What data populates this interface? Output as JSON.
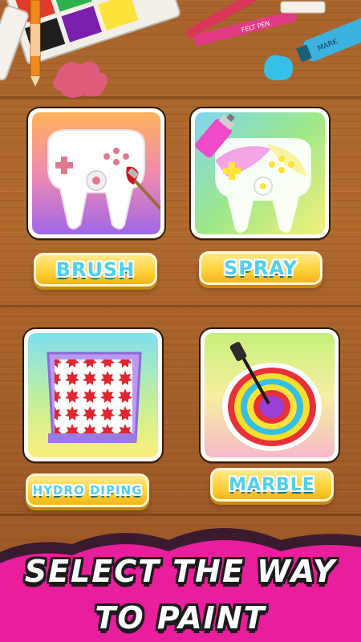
{
  "modes": [
    {
      "id": "brush",
      "label": "BRUSH",
      "icon": "controller-brush-icon"
    },
    {
      "id": "spray",
      "label": "SPRAY",
      "icon": "controller-spray-icon"
    },
    {
      "id": "hydro",
      "label": "HYDRO DIPING",
      "icon": "hydro-dip-box-icon"
    },
    {
      "id": "marble",
      "label": "MARBLE",
      "icon": "marble-bowl-icon"
    }
  ],
  "banner": {
    "line1": "SELECT THE WAY",
    "line2": "TO PAINT"
  },
  "decor": {
    "felt_pen_label": "FELT PEN",
    "marker_label": "MARK"
  },
  "colors": {
    "label_text": "#4fd0ee",
    "button_yellow": "#ffd23a",
    "banner_magenta": "#e81e9c",
    "wood": "#a8642c"
  }
}
